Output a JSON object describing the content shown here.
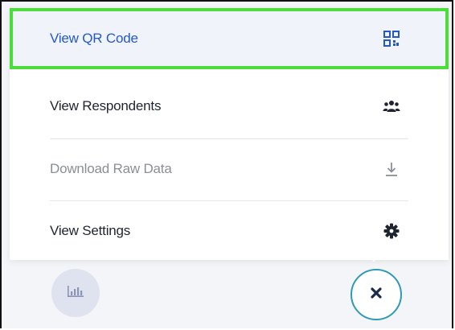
{
  "menu": {
    "items": [
      {
        "id": "qr",
        "label": "View QR Code",
        "icon": "qr-code-icon",
        "highlighted": true
      },
      {
        "id": "respondents",
        "label": "View Respondents",
        "icon": "users-icon"
      },
      {
        "id": "download",
        "label": "Download Raw Data",
        "icon": "download-icon",
        "disabled": true
      },
      {
        "id": "settings",
        "label": "View Settings",
        "icon": "gear-icon"
      }
    ]
  },
  "buttons": {
    "chart_icon": "bar-chart-icon",
    "close_icon": "close-icon"
  },
  "colors": {
    "highlight_border": "#4cdc3c",
    "link_blue": "#2458c9",
    "close_ring": "#2f9ab5",
    "dark_navy": "#1d2a4d"
  }
}
